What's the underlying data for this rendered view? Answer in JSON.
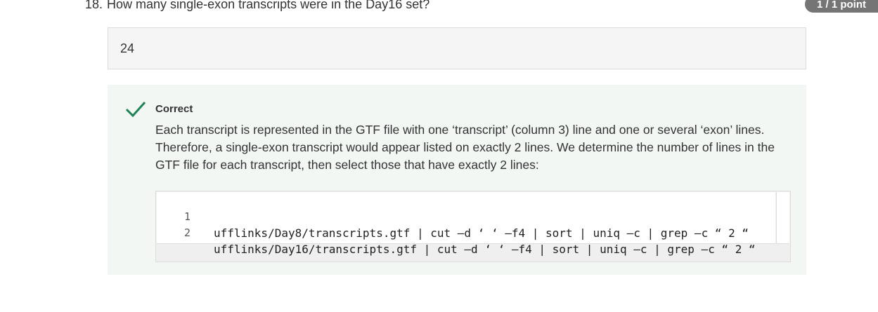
{
  "question": {
    "number": "18.",
    "text": "How many single-exon transcripts were in the Day16 set?",
    "score": "1 / 1 point"
  },
  "answer": {
    "value": "24"
  },
  "feedback": {
    "status_icon": "checkmark-icon",
    "status": "Correct",
    "explanation": "Each transcript is represented in the GTF file with one ‘transcript’ (column 3) line and one or several ‘exon’ lines. Therefore, a single-exon transcript would appear listed on exactly 2 lines. We determine the number of lines in the GTF file for each transcript, then select those that have exactly 2 lines:",
    "accent_color": "#1f8354",
    "code": [
      {
        "line_number": "1",
        "text": "ufflinks/Day8/transcripts.gtf | cut –d ‘ ‘ –f4 | sort | uniq –c | grep –c “ 2 “"
      },
      {
        "line_number": "2",
        "text": "ufflinks/Day16/transcripts.gtf | cut –d ‘ ‘ –f4 | sort | uniq –c | grep –c “ 2 “"
      }
    ]
  }
}
